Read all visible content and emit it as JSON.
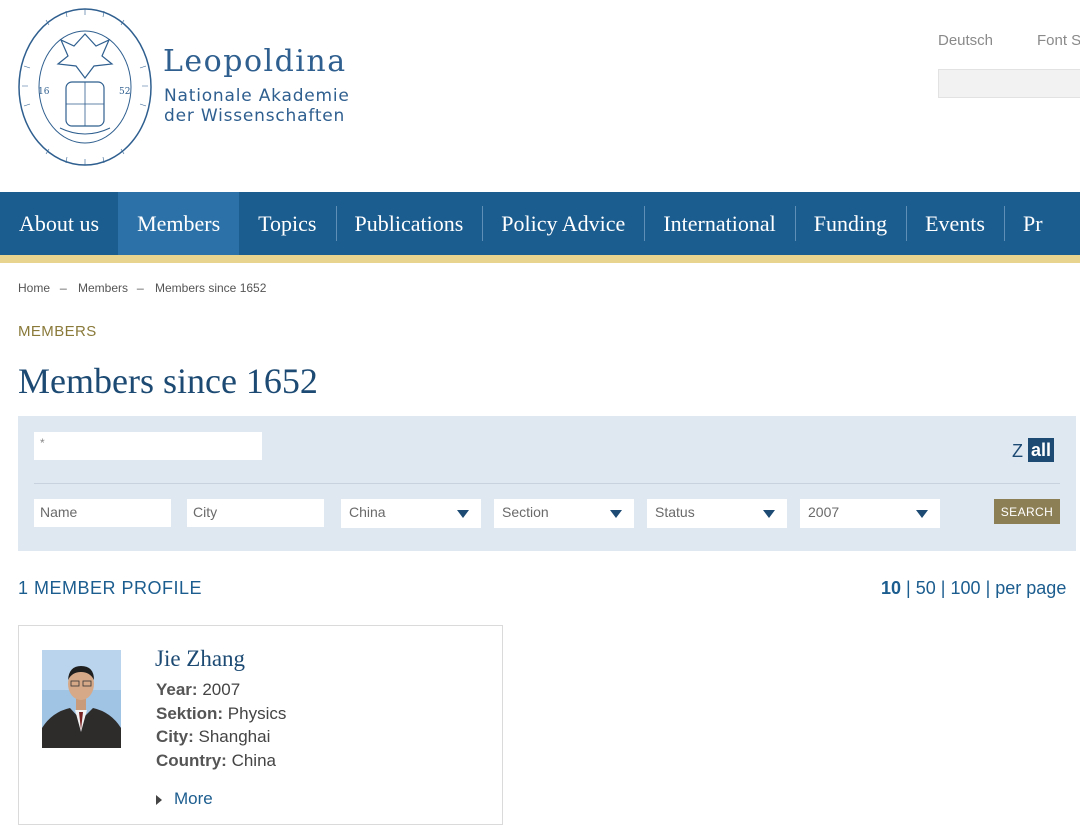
{
  "header": {
    "logo_title": "Leopoldina",
    "logo_sub_1": "Nationale Akademie",
    "logo_sub_2": "der Wissenschaften",
    "language_link": "Deutsch",
    "font_size_link": "Font S"
  },
  "nav": {
    "items": [
      "About us",
      "Members",
      "Topics",
      "Publications",
      "Policy Advice",
      "International",
      "Funding",
      "Events",
      "Pr"
    ],
    "active": "Members"
  },
  "breadcrumb": [
    "Home",
    "Members",
    "Members since 1652"
  ],
  "breadcrumb_separator": "_",
  "kicker": "MEMBERS",
  "page_title": "Members since 1652",
  "filters": {
    "query_value": "*",
    "az_letter": "Z",
    "az_all": "all",
    "name_placeholder": "Name",
    "city_placeholder": "City",
    "country_value": "China",
    "section_value": "Section",
    "status_value": "Status",
    "year_value": "2007",
    "search_label": "SEARCH"
  },
  "results": {
    "count_label": "1 MEMBER PROFILE",
    "per_page": {
      "opt1": "10",
      "opt2": "50",
      "opt3": "100",
      "sep": "|",
      "suffix": "per page"
    }
  },
  "member": {
    "name": "Jie Zhang",
    "year_label": "Year:",
    "year": "2007",
    "section_label": "Sektion:",
    "section": "Physics",
    "city_label": "City:",
    "city": "Shanghai",
    "country_label": "Country:",
    "country": "China",
    "more_label": "More"
  },
  "colors": {
    "nav_bg": "#1c5d8f",
    "nav_active": "#2c72a8",
    "accent_gold": "#e9d48f",
    "title_blue": "#1c4a73",
    "search_button": "#8d7f55"
  }
}
